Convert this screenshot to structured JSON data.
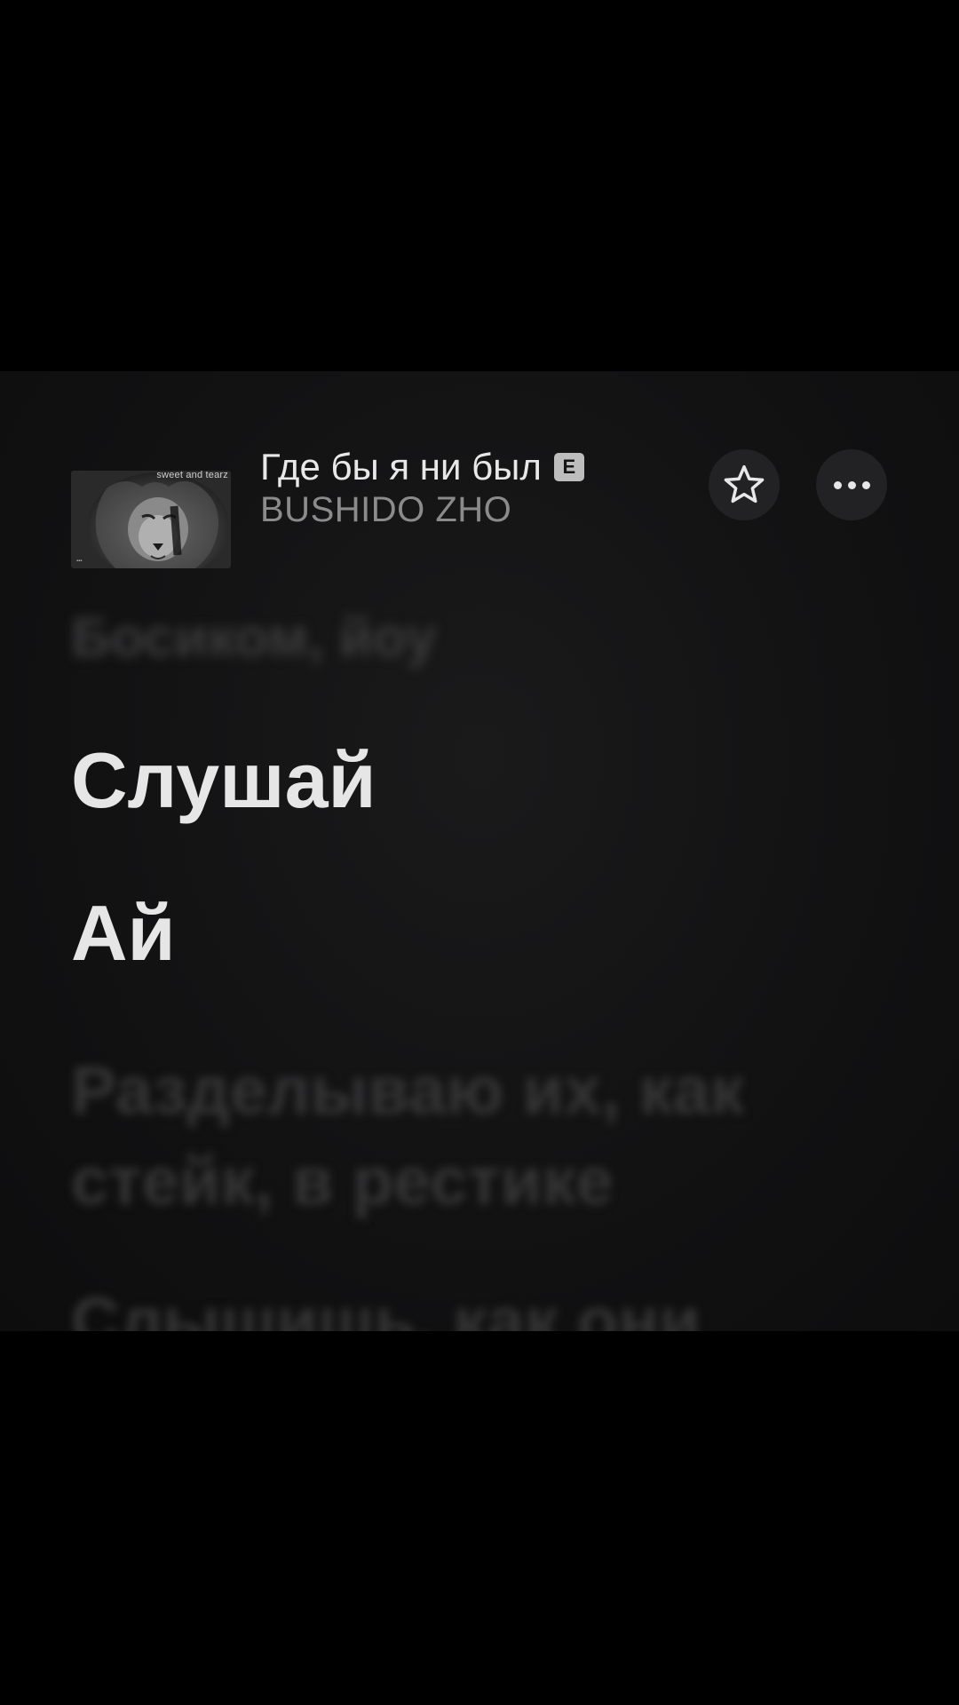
{
  "track": {
    "title": "Где бы я ни был",
    "explicit_badge": "E",
    "artist": "BUSHIDO ZHO",
    "artwork_caption": "sweet and tearz"
  },
  "buttons": {
    "favorite_icon": "star-icon",
    "more_icon": "ellipsis-icon"
  },
  "lyrics": {
    "previous_line_blurred": "Босиком, йоу",
    "active_lines": [
      "Слушай",
      "Ай"
    ],
    "next_lines_blurred": [
      "Разделываю их, как",
      "стейк, в рестике",
      "Слышишь, как они"
    ]
  }
}
